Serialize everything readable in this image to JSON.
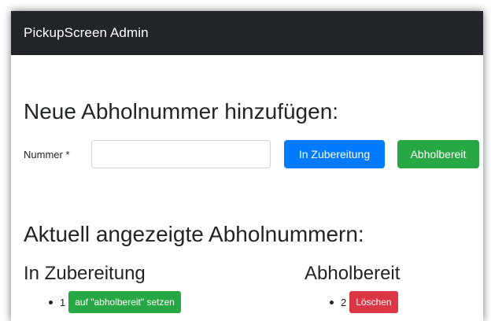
{
  "navbar": {
    "brand": "PickupScreen Admin"
  },
  "add_section": {
    "title": "Neue Abholnummer hinzufügen:",
    "field_label": "Nummer *",
    "field_value": "",
    "field_placeholder": "",
    "btn_preparing": "In Zubereitung",
    "btn_ready": "Abholbereit"
  },
  "current_section": {
    "title": "Aktuell angezeigte Abholnummern:",
    "preparing": {
      "heading": "In Zubereitung",
      "items": [
        {
          "number": "1",
          "action": "auf \"abholbereit\" setzen"
        }
      ]
    },
    "ready": {
      "heading": "Abholbereit",
      "items": [
        {
          "number": "2",
          "action": "Löschen"
        }
      ]
    }
  },
  "colors": {
    "navbar_bg": "#212529",
    "primary": "#007bff",
    "success": "#28a745",
    "danger": "#dc3545"
  }
}
